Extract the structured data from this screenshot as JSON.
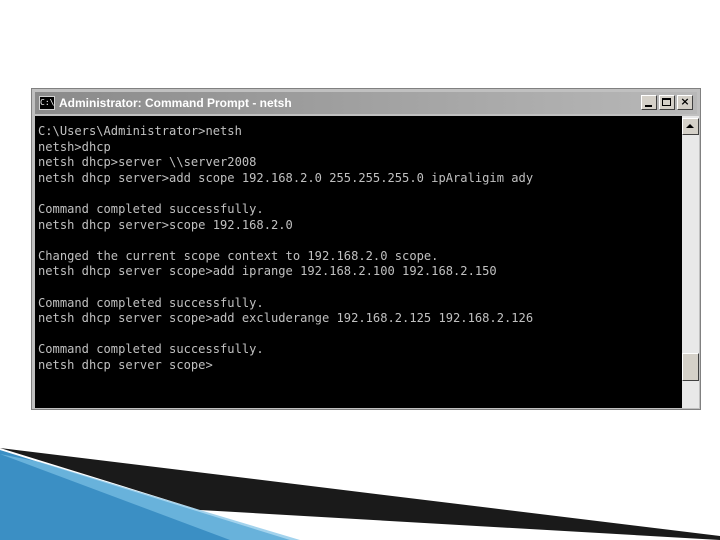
{
  "window": {
    "title": "Administrator: Command Prompt - netsh",
    "icon": "cmd-icon",
    "icon_text": "C:\\"
  },
  "console": {
    "lines": [
      "C:\\Users\\Administrator>netsh",
      "netsh>dhcp",
      "netsh dhcp>server \\\\server2008",
      "netsh dhcp server>add scope 192.168.2.0 255.255.255.0 ipAraligim ady",
      "",
      "Command completed successfully.",
      "netsh dhcp server>scope 192.168.2.0",
      "",
      "Changed the current scope context to 192.168.2.0 scope.",
      "netsh dhcp server scope>add iprange 192.168.2.100 192.168.2.150",
      "",
      "Command completed successfully.",
      "netsh dhcp server scope>add excluderange 192.168.2.125 192.168.2.126",
      "",
      "Command completed successfully.",
      "netsh dhcp server scope>"
    ]
  },
  "colors": {
    "console_bg": "#000000",
    "console_text": "#c0c0c0",
    "slide_accent_dark": "#1a1a1a",
    "slide_accent_blue": "#3b8fc4"
  }
}
